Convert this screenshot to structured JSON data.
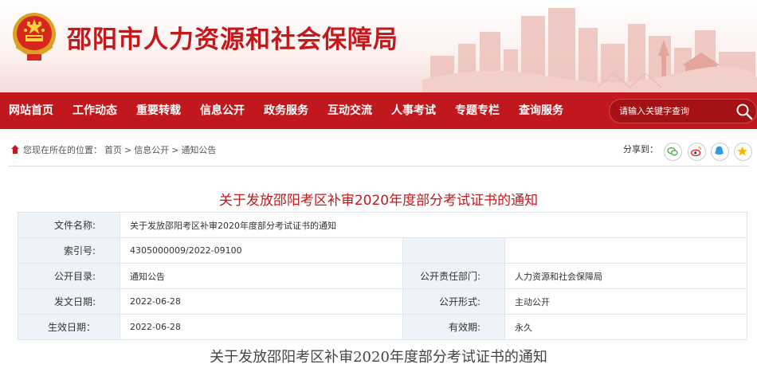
{
  "header": {
    "site_title": "邵阳市人力资源和社会保障局"
  },
  "nav": {
    "items": [
      "网站首页",
      "工作动态",
      "重要转载",
      "信息公开",
      "政务服务",
      "互动交流",
      "人事考试",
      "专题专栏",
      "查询服务"
    ]
  },
  "search": {
    "placeholder": "请输入关键字查询"
  },
  "breadcrumb": {
    "prefix": "您现在所在的位置：",
    "items": [
      "首页",
      "信息公开",
      "通知公告"
    ],
    "separator": ">"
  },
  "share": {
    "label": "分享到："
  },
  "document": {
    "title": "关于发放邵阳考区补审2020年度部分考试证书的通知",
    "body_title": "关于发放邵阳考区补审2020年度部分考试证书的通知"
  },
  "info_table": {
    "file_name_label": "文件名称:",
    "file_name_value": "关于发放邵阳考区补审2020年度部分考试证书的通知",
    "index_label": "索引号:",
    "index_value": "4305000009/2022-09100",
    "catalog_label": "公开目录:",
    "catalog_value": "通知公告",
    "dept_label": "公开责任部门:",
    "dept_value": "人力资源和社会保障局",
    "issue_date_label": "发文日期:",
    "issue_date_value": "2022-06-28",
    "form_label": "公开形式:",
    "form_value": "主动公开",
    "effective_label": "生效日期：",
    "effective_value": "2022-06-28",
    "validity_label": "有效期:",
    "validity_value": "永久"
  },
  "colors": {
    "brand_red": "#c0181c",
    "label_bg": "#eef3fa"
  }
}
